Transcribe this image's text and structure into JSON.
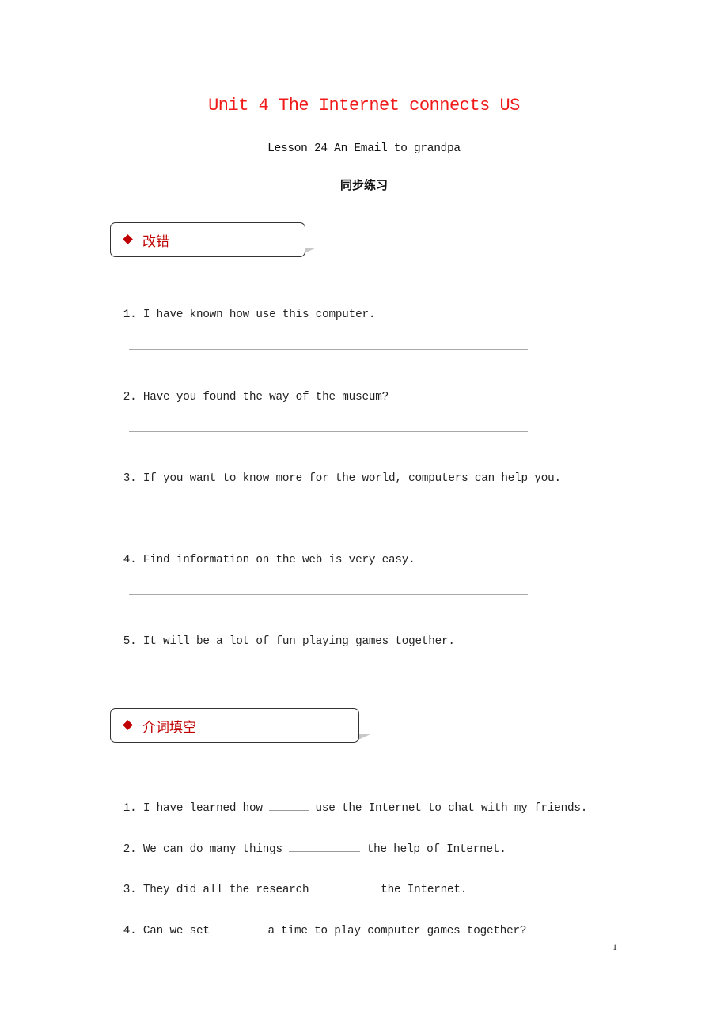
{
  "document": {
    "title": "Unit 4 The Internet connects US",
    "lesson": "Lesson 24 An Email to grandpa",
    "subtitle_cn": "同步练习",
    "title_color": "#f01818",
    "accent_color": "#c00000"
  },
  "sections": [
    {
      "label": "改错",
      "icon": "diamond-icon",
      "questions": [
        {
          "number": "1.",
          "text": "I have known how use this computer."
        },
        {
          "number": "2.",
          "text": "Have you found the way of the museum?"
        },
        {
          "number": "3.",
          "text": "If you want to know more for the world, computers can help you."
        },
        {
          "number": "4.",
          "text": "Find information on the web is very easy."
        },
        {
          "number": "5.",
          "text": "It will be a lot of fun playing games together."
        }
      ]
    },
    {
      "label": "介词填空",
      "icon": "diamond-icon",
      "questions": [
        {
          "number": "1.",
          "before": "I have learned how",
          "after": "use the Internet to chat with my friends."
        },
        {
          "number": "2.",
          "before": "We can do many things",
          "after": "the help of Internet."
        },
        {
          "number": "3.",
          "before": "They did all the research",
          "after": "the Internet."
        },
        {
          "number": "4.",
          "before": "Can we set",
          "after": "a time to play computer games together?"
        }
      ]
    }
  ],
  "footer": {
    "page_number": "1"
  }
}
